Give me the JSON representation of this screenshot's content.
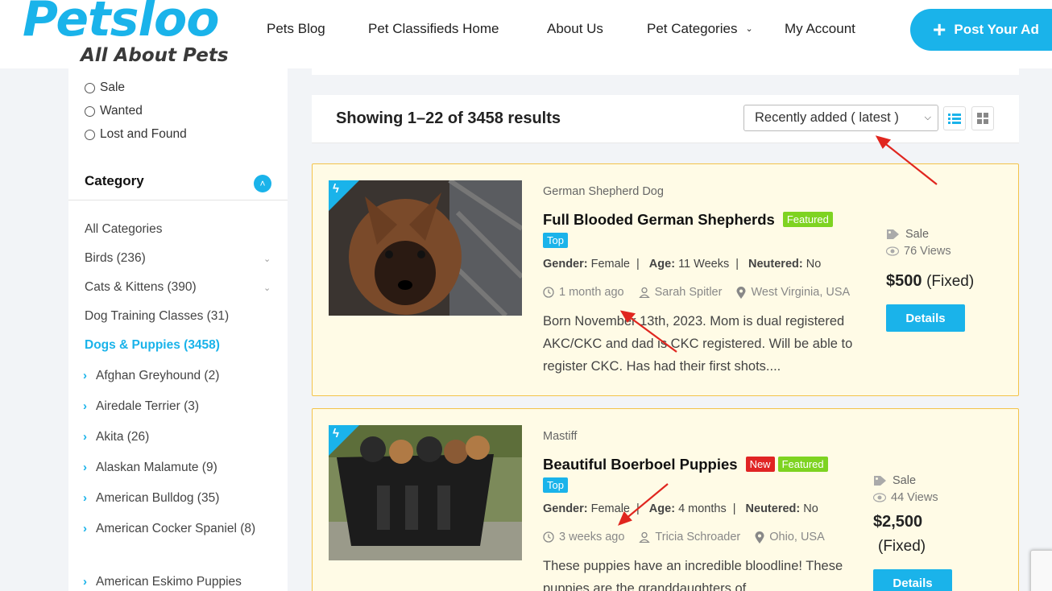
{
  "brand": {
    "logo": "Petsloo",
    "tagline": "All About Pets",
    "accent": "#1ab3ea"
  },
  "nav": {
    "items": [
      "Pets Blog",
      "Pet Classifieds Home",
      "About Us",
      "Pet Categories",
      "My Account"
    ],
    "post_ad": "Post Your Ad"
  },
  "sidebar": {
    "ad_types": [
      "Sale",
      "Wanted",
      "Lost and Found"
    ],
    "category_title": "Category",
    "categories": [
      "All Categories",
      "Birds (236)",
      "Cats & Kittens (390)",
      "Dog Training Classes (31)",
      "Dogs & Puppies (3458)"
    ],
    "subcategories": [
      "Afghan Greyhound (2)",
      "Airedale Terrier (3)",
      "Akita (26)",
      "Alaskan Malamute (9)",
      "American Bulldog (35)",
      "American Cocker Spaniel (8)",
      "American Eskimo Puppies"
    ]
  },
  "results": {
    "summary": "Showing 1–22 of 3458 results",
    "sort_value": "Recently added ( latest )"
  },
  "labels": {
    "gender": "Gender:",
    "age": "Age:",
    "neutered": "Neutered:",
    "sep": "|"
  },
  "listings": [
    {
      "breed": "German Shepherd Dog",
      "title": "Full Blooded German Shepherds",
      "tags": [
        "Featured"
      ],
      "top": "Top",
      "gender": "Female",
      "age": "11 Weeks",
      "neutered": "No",
      "posted": "1 month ago",
      "author": "Sarah Spitler",
      "location": "West Virginia, USA",
      "description": "Born November 13th, 2023. Mom is dual registered AKC/CKC and dad is CKC registered. Will be able to register CKC. Has had their first shots....",
      "type": "Sale",
      "views": "76 Views",
      "price": "$500",
      "price_type": "(Fixed)",
      "details": "Details"
    },
    {
      "breed": "Mastiff",
      "title": "Beautiful Boerboel Puppies",
      "tags": [
        "New",
        "Featured"
      ],
      "top": "Top",
      "gender": "Female",
      "age": "4 months",
      "neutered": "No",
      "posted": "3 weeks ago",
      "author": "Tricia Schroader",
      "location": "Ohio, USA",
      "description": "These puppies have an incredible bloodline! These puppies are the granddaughters of",
      "type": "Sale",
      "views": "44 Views",
      "price": "$2,500",
      "price_type": "(Fixed)",
      "details": "Details"
    }
  ]
}
